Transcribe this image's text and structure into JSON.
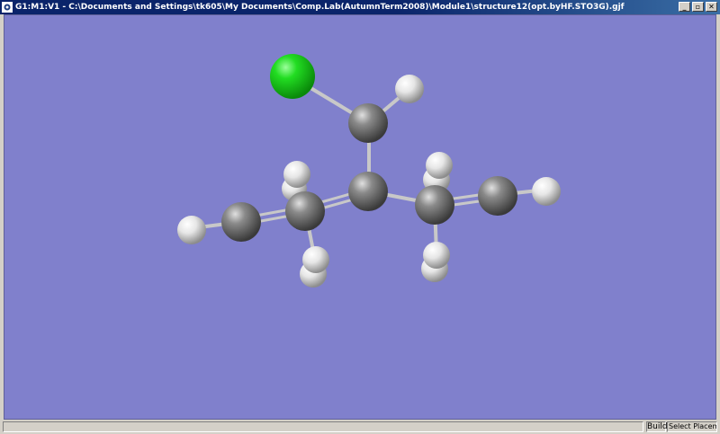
{
  "window": {
    "title": "G1:M1:V1 - C:\\Documents and Settings\\tk605\\My Documents\\Comp.Lab(AutumnTerm2008)\\Module1\\structure12(opt.byHF.STO3G).gjf",
    "icon": "gaussview-icon",
    "buttons": {
      "minimize": "_",
      "restore": "▫",
      "close": "✕"
    }
  },
  "viewport": {
    "background": "#8080cc",
    "atom_colors": {
      "Cl": "#22dd22",
      "C": "#8a8a8a",
      "H": "#e8e8e8"
    }
  },
  "statusbar": {
    "message": "",
    "mode": "Build",
    "action": "Select Placement"
  }
}
